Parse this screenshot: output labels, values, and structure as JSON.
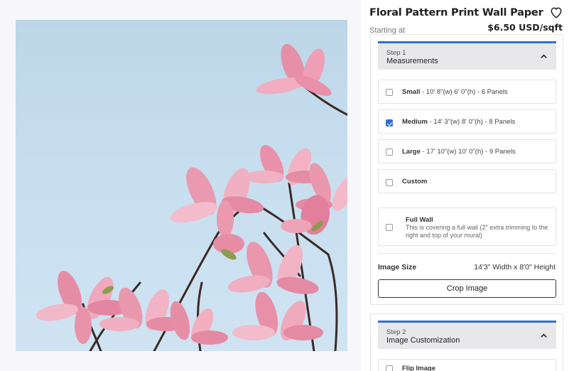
{
  "product": {
    "title": "Floral Pattern Print Wall Paper",
    "starting_label": "Starting at",
    "price": "$6.50 USD/sqft",
    "favorite_icon": "heart-icon",
    "image_subject": "pink magnolia blossoms against light blue sky"
  },
  "step1": {
    "step_label": "Step 1",
    "name": "Measurements",
    "toggle_icon": "chevron-up-icon",
    "options": [
      {
        "name": "Small",
        "detail": " - 10' 8\"(w) 6' 0\"(h) - 6 Panels",
        "checked": false
      },
      {
        "name": "Medium",
        "detail": " - 14' 3\"(w) 8' 0\"(h) - 8 Panels",
        "checked": true
      },
      {
        "name": "Large",
        "detail": " - 17' 10\"(w) 10' 0\"(h) - 9 Panels",
        "checked": false
      },
      {
        "name": "Custom",
        "detail": "",
        "checked": false
      }
    ],
    "full_wall": {
      "title": "Full Wall",
      "description": "This is covering a full wall (2\" extra trimming to the right and top of your mural)",
      "checked": false
    },
    "image_size_label": "Image Size",
    "image_size_value": "14'3\" Width x 8'0\" Height",
    "crop_button": "Crop Image"
  },
  "step2": {
    "step_label": "Step 2",
    "name": "Image Customization",
    "toggle_icon": "chevron-up-icon",
    "flip_label": "Flip Image",
    "flip_checked": false
  },
  "colors": {
    "accent": "#2f6fd6",
    "header_bg": "#e8e8ea"
  }
}
